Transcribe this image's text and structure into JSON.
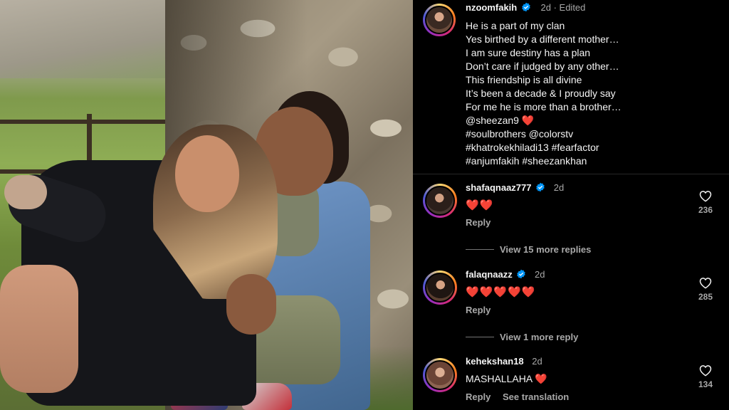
{
  "post": {
    "author": "nzoomfakih",
    "time": "2d",
    "edited": "Edited",
    "caption_lines": [
      "He is a part of my clan",
      "Yes birthed by a different mother…",
      "I am sure destiny has a plan",
      "Don’t care if judged by any other…",
      "This friendship is all divine",
      "It’s been a decade & I proudly say",
      "For me he is more than a brother…",
      "@sheezan9",
      "#soulbrothers @colorstv",
      "#khatrokekhiladi13 #fearfactor",
      "#anjumfakih #sheezankhan"
    ],
    "caption_emoji": "❤️"
  },
  "comments": [
    {
      "username": "shafaqnaaz777",
      "verified": true,
      "time": "2d",
      "text": "❤️❤️",
      "reply_label": "Reply",
      "likes": "236",
      "view_more": "View 15 more replies"
    },
    {
      "username": "falaqnaazz",
      "verified": true,
      "time": "2d",
      "text": "❤️❤️❤️❤️❤️",
      "reply_label": "Reply",
      "likes": "285",
      "view_more": "View 1 more reply"
    },
    {
      "username": "kehekshan18",
      "verified": false,
      "time": "2d",
      "text": "MASHALLAHA",
      "text_emoji": "❤️",
      "reply_label": "Reply",
      "translation_label": "See translation",
      "likes": "134"
    }
  ],
  "colors": {
    "background": "#000000",
    "text": "#f5f5f5",
    "secondary": "#a8a8a8",
    "verified": "#0095f6",
    "heart": "#ed4956"
  }
}
